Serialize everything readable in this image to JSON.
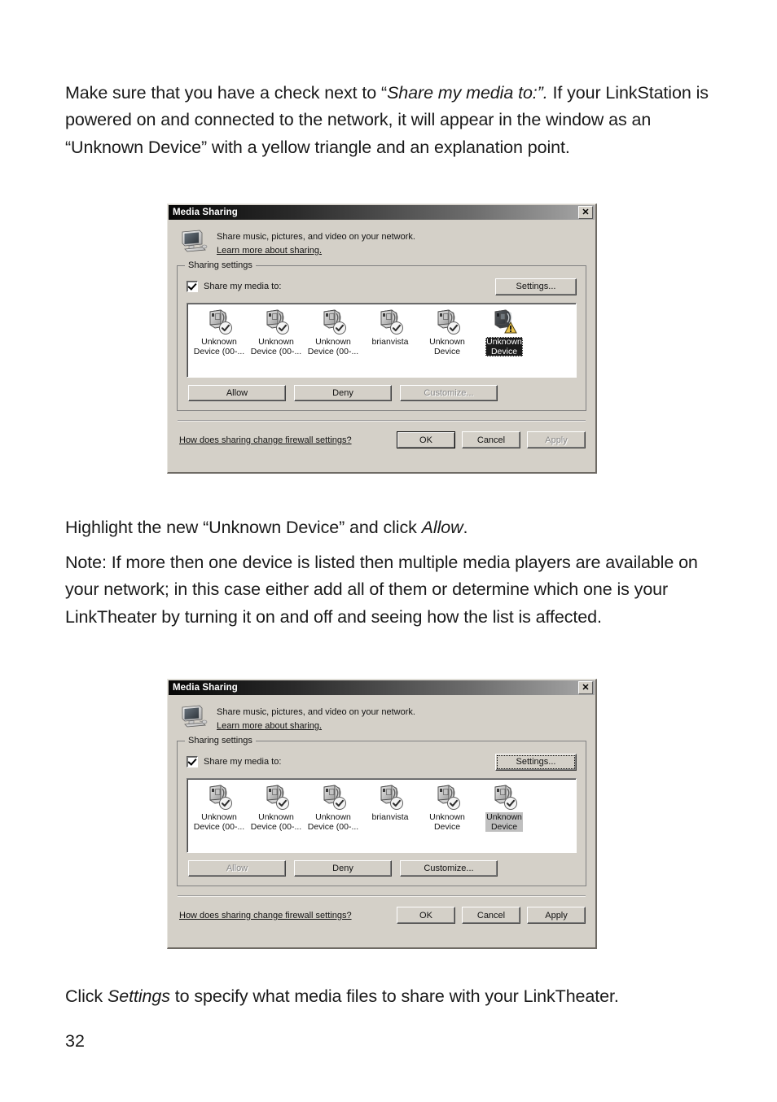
{
  "document": {
    "page_number": "32",
    "paragraphs": {
      "intro_a": "Make sure that you have a check next to “",
      "intro_i": "Share my media to:”.",
      "intro_b": "  If your LinkStation is powered on and connected to the network, it will appear in the window as an “Unknown Device” with a yellow triangle and an explanation point.",
      "highlight_a": "Highlight the new “Unknown Device” and click ",
      "highlight_i": "Allow",
      "highlight_b": ".",
      "note": "Note:  If more then one device is listed then multiple media players are available on your network; in this case either add all of them or determine which one is your LinkTheater by turning it on and off and seeing how the list is affected.",
      "click_a": "Click ",
      "click_i": "Settings",
      "click_b": " to specify what media files to share with your LinkTheater."
    }
  },
  "dialog_one": {
    "title": "Media Sharing",
    "close_label": "✕",
    "header": {
      "description": "Share music, pictures, and video on your network.",
      "link": "Learn more about sharing.",
      "icon": "computer-monitor-icon"
    },
    "group": {
      "legend": "Sharing settings",
      "checkbox_label": "Share my media to:",
      "checkbox_checked": true,
      "settings_button": "Settings...",
      "settings_focused": false
    },
    "devices": [
      {
        "label": "Unknown\nDevice (00-...",
        "badge": "check",
        "state": "normal"
      },
      {
        "label": "Unknown\nDevice (00-...",
        "badge": "check",
        "state": "normal"
      },
      {
        "label": "Unknown\nDevice (00-...",
        "badge": "check",
        "state": "normal"
      },
      {
        "label": "brianvista",
        "badge": "check",
        "state": "normal"
      },
      {
        "label": "Unknown\nDevice",
        "badge": "check",
        "state": "normal"
      },
      {
        "label": "Unknown\nDevice",
        "badge": "warning",
        "state": "selected-active"
      }
    ],
    "actions": [
      {
        "label": "Allow",
        "disabled": false
      },
      {
        "label": "Deny",
        "disabled": false
      },
      {
        "label": "Customize...",
        "disabled": true
      }
    ],
    "footer": {
      "link": "How does sharing change firewall settings?",
      "buttons": [
        {
          "label": "OK",
          "disabled": false,
          "default": true
        },
        {
          "label": "Cancel",
          "disabled": false,
          "default": false
        },
        {
          "label": "Apply",
          "disabled": true,
          "default": false
        }
      ]
    }
  },
  "dialog_two": {
    "title": "Media Sharing",
    "close_label": "✕",
    "header": {
      "description": "Share music, pictures, and video on your network.",
      "link": "Learn more about sharing.",
      "icon": "computer-monitor-icon"
    },
    "group": {
      "legend": "Sharing settings",
      "checkbox_label": "Share my media to:",
      "checkbox_checked": true,
      "settings_button": "Settings...",
      "settings_focused": true
    },
    "devices": [
      {
        "label": "Unknown\nDevice (00-...",
        "badge": "check",
        "state": "normal"
      },
      {
        "label": "Unknown\nDevice (00-...",
        "badge": "check",
        "state": "normal"
      },
      {
        "label": "Unknown\nDevice (00-...",
        "badge": "check",
        "state": "normal"
      },
      {
        "label": "brianvista",
        "badge": "check",
        "state": "normal"
      },
      {
        "label": "Unknown\nDevice",
        "badge": "check",
        "state": "normal"
      },
      {
        "label": "Unknown\nDevice",
        "badge": "check",
        "state": "selected-inactive"
      }
    ],
    "actions": [
      {
        "label": "Allow",
        "disabled": true
      },
      {
        "label": "Deny",
        "disabled": false
      },
      {
        "label": "Customize...",
        "disabled": false
      }
    ],
    "footer": {
      "link": "How does sharing change firewall settings?",
      "buttons": [
        {
          "label": "OK",
          "disabled": false,
          "default": false
        },
        {
          "label": "Cancel",
          "disabled": false,
          "default": false
        },
        {
          "label": "Apply",
          "disabled": false,
          "default": false
        }
      ]
    }
  },
  "colors": {
    "dialog_face": "#d4d0c8",
    "titlebar_dark": "#070707",
    "selection_active": "#1c1c1c",
    "selection_inactive": "#c0c0c0",
    "warning_yellow": "#e8c24a",
    "page_background": "#ffffff"
  }
}
